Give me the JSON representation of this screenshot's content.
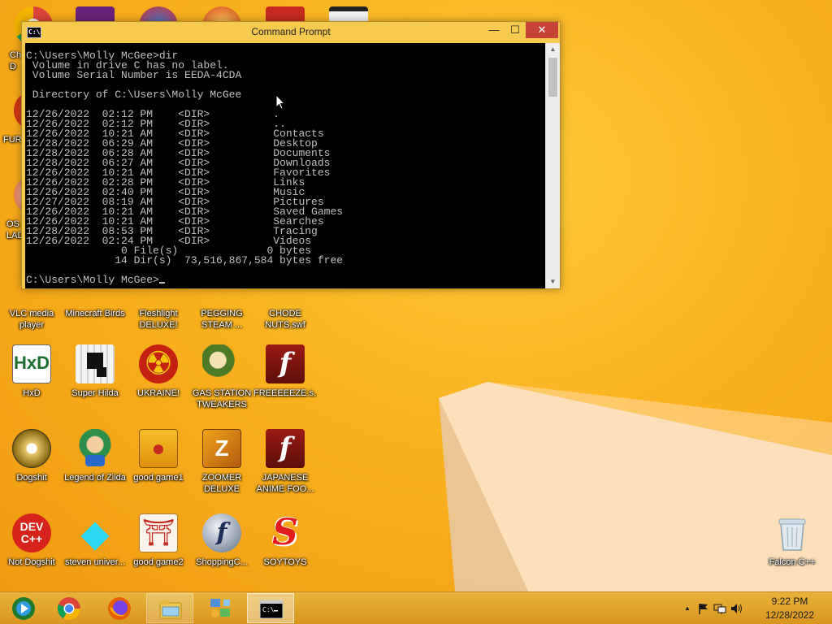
{
  "desktop": {
    "icons": [
      {
        "label": "Ch\nD",
        "col": "chrome-partial"
      },
      {
        "label": "FUR",
        "col": "fur-partial"
      },
      {
        "label": "OS\nLAD",
        "col": "os-partial"
      },
      {
        "label": "VLC media player"
      },
      {
        "label": "Minecraft Birds"
      },
      {
        "label": "Fleshlight DELUXE!"
      },
      {
        "label": "PEGGING STEAM ..."
      },
      {
        "label": "CHODE NUTS.swf"
      },
      {
        "label": "HxD"
      },
      {
        "label": "Super Hilda"
      },
      {
        "label": "UKRAINE!"
      },
      {
        "label": "GAS STATION TWEAKERS"
      },
      {
        "label": "FREEEEEZE.s..."
      },
      {
        "label": "Dogshit"
      },
      {
        "label": "Legend of Zilda"
      },
      {
        "label": "good game1"
      },
      {
        "label": "ZOOMER DELUXE"
      },
      {
        "label": "JAPANESE ANIME FOO..."
      },
      {
        "label": "Not Dogshit"
      },
      {
        "label": "steven univer..."
      },
      {
        "label": "good game2"
      },
      {
        "label": "ShoppingC..."
      },
      {
        "label": "SOYTOYS"
      },
      {
        "label": "Falcon C++"
      }
    ],
    "icon_glyphs": {
      "hxd": "HxD",
      "devc": "DEV\nC++",
      "torii": "⛩",
      "flash": "f",
      "soy": "S",
      "zoomer": "Z"
    }
  },
  "cmd": {
    "title": "Command Prompt",
    "app_icon_text": "C:\\",
    "minimize": "—",
    "maximize": "☐",
    "close": "✕",
    "scroll_up": "▲",
    "scroll_down": "▼",
    "lines": [
      "C:\\Users\\Molly McGee>dir",
      " Volume in drive C has no label.",
      " Volume Serial Number is EEDA-4CDA",
      "",
      " Directory of C:\\Users\\Molly McGee",
      "",
      "12/26/2022  02:12 PM    <DIR>          .",
      "12/26/2022  02:12 PM    <DIR>          ..",
      "12/26/2022  10:21 AM    <DIR>          Contacts",
      "12/28/2022  06:29 AM    <DIR>          Desktop",
      "12/28/2022  06:28 AM    <DIR>          Documents",
      "12/28/2022  06:27 AM    <DIR>          Downloads",
      "12/26/2022  10:21 AM    <DIR>          Favorites",
      "12/26/2022  02:28 PM    <DIR>          Links",
      "12/26/2022  02:40 PM    <DIR>          Music",
      "12/27/2022  08:19 AM    <DIR>          Pictures",
      "12/26/2022  10:21 AM    <DIR>          Saved Games",
      "12/26/2022  10:21 AM    <DIR>          Searches",
      "12/28/2022  08:53 PM    <DIR>          Tracing",
      "12/26/2022  02:24 PM    <DIR>          Videos",
      "               0 File(s)              0 bytes",
      "              14 Dir(s)  73,516,867,584 bytes free",
      "",
      "C:\\Users\\Molly McGee>"
    ],
    "text_color": "#c0c0c0",
    "background": "#000000"
  },
  "taskbar": {
    "pinned": [
      {
        "name": "media-center"
      },
      {
        "name": "chrome"
      },
      {
        "name": "firefox"
      },
      {
        "name": "file-explorer"
      },
      {
        "name": "network"
      },
      {
        "name": "command-prompt"
      }
    ],
    "tray": {
      "expand": "▲",
      "time": "9:22 PM",
      "date": "12/28/2022"
    }
  }
}
